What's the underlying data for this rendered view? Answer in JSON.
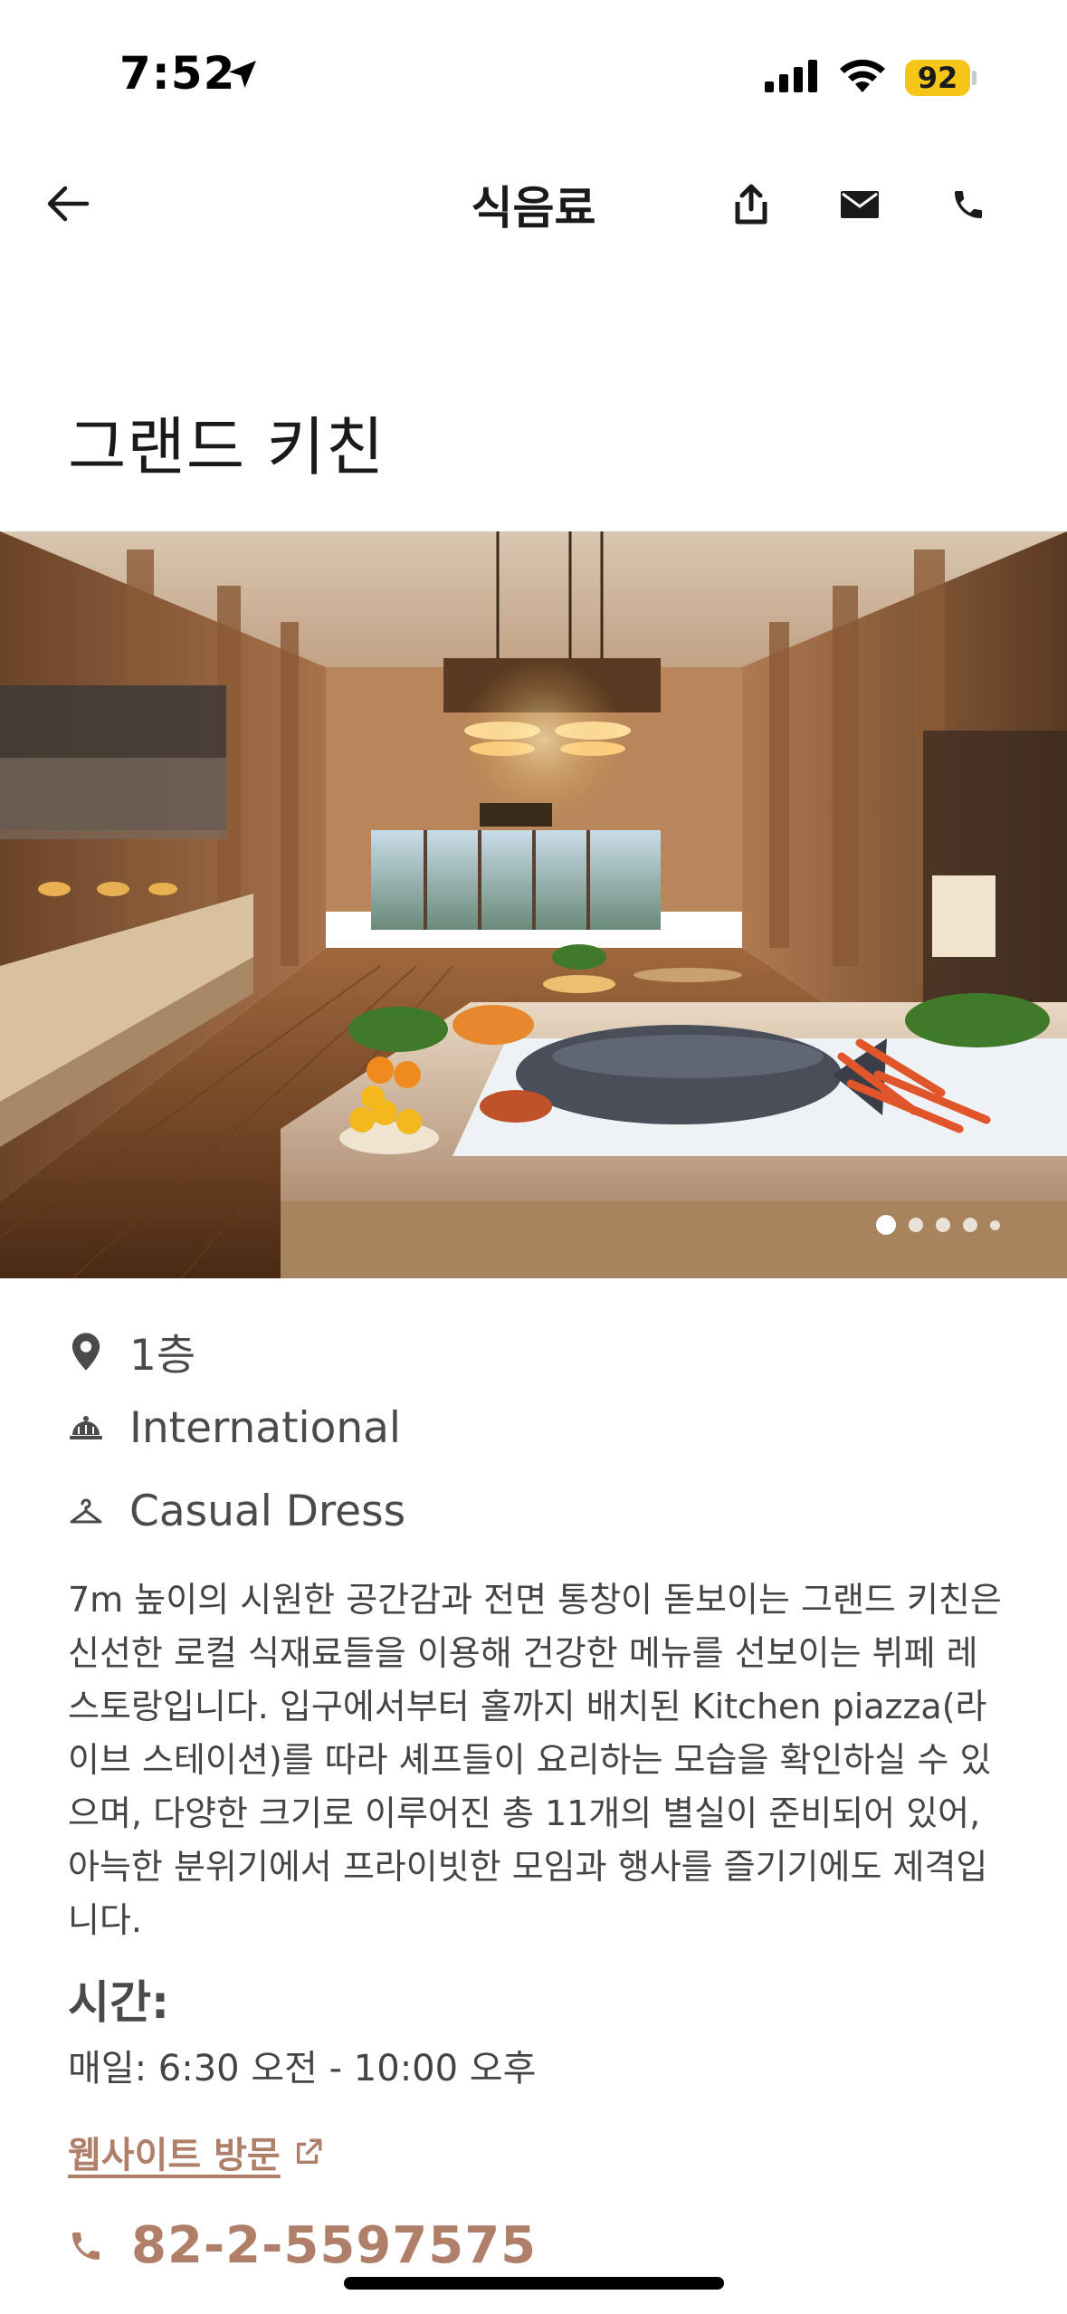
{
  "status_bar": {
    "time": "7:52",
    "battery": "92",
    "icons": [
      "location-arrow-icon",
      "signal-icon",
      "wifi-icon",
      "battery-icon"
    ]
  },
  "nav": {
    "title": "식음료",
    "icons": [
      "back-arrow-icon",
      "share-icon",
      "mail-icon",
      "phone-icon"
    ]
  },
  "restaurant": {
    "name": "그랜드 키친",
    "gallery": {
      "total": 5,
      "active": 1
    },
    "floor": "1층",
    "cuisine": "International",
    "dress_code": "Casual Dress",
    "description": "7m 높이의 시원한 공간감과 전면 통창이 돋보이는 그랜드 키친은 신선한 로컬 식재료들을 이용해 건강한 메뉴를 선보이는 뷔페 레스토랑입니다. 입구에서부터 홀까지 배치된 Kitchen piazza(라이브 스테이션)를 따라 셰프들이 요리하는 모습을 확인하실 수 있으며, 다양한 크기로 이루어진 총 11개의 별실이 준비되어 있어, 아늑한 분위기에서 프라이빗한 모임과 행사를 즐기기에도 제격입니다.",
    "hours_heading": "시간:",
    "hours": "매일: 6:30 오전 - 10:00 오후",
    "website_label": "웹사이트 방문",
    "phone": "82-2-5597575"
  },
  "colors": {
    "accent": "#b07f69",
    "battery": "#f5c518",
    "text_secondary": "#4a4a4a"
  }
}
